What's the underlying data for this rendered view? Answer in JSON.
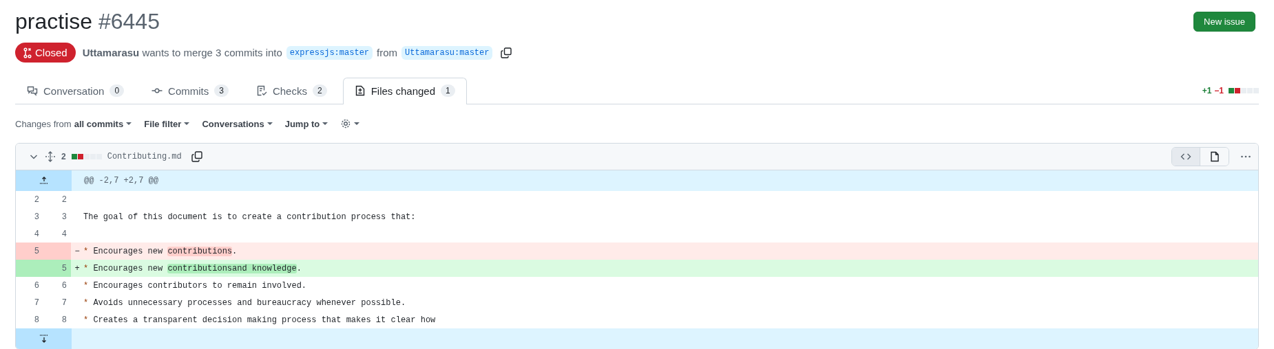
{
  "title": "practise",
  "number": "#6445",
  "new_issue_button": "New issue",
  "status": {
    "label": "Closed",
    "kind": "closed"
  },
  "summary": {
    "author": "Uttamarasu",
    "text": "wants to merge 3 commits into",
    "base": "expressjs:master",
    "from": "from",
    "head": "Uttamarasu:master"
  },
  "tabs": [
    {
      "label": "Conversation",
      "count": "0",
      "selected": false
    },
    {
      "label": "Commits",
      "count": "3",
      "selected": false
    },
    {
      "label": "Checks",
      "count": "2",
      "selected": false
    },
    {
      "label": "Files changed",
      "count": "1",
      "selected": true
    }
  ],
  "totals": {
    "additions": "+1",
    "deletions": "−1",
    "blocks": [
      {
        "color": "#1f883d"
      },
      {
        "color": "#cf222e"
      },
      {
        "color": "#eaeef2"
      },
      {
        "color": "#eaeef2"
      },
      {
        "color": "#eaeef2"
      }
    ]
  },
  "toolbar": {
    "changes_label": "Changes from",
    "changes_value": "all commits",
    "menus": [
      "File filter",
      "Conversations",
      "Jump to"
    ]
  },
  "file": {
    "expanded": true,
    "changes": "2",
    "name": "Contributing.md",
    "blocks": [
      {
        "color": "#1f883d"
      },
      {
        "color": "#cf222e"
      },
      {
        "color": "#eaeef2"
      },
      {
        "color": "#eaeef2"
      },
      {
        "color": "#eaeef2"
      }
    ],
    "lines": [
      {
        "kind": "hunk",
        "text": "@@ -2,7 +2,7 @@"
      },
      {
        "kind": "context",
        "old": "2",
        "new": "2"
      },
      {
        "kind": "context",
        "old": "3",
        "new": "3",
        "segments": [
          {
            "text": "The goal of this document is to create a contribution process that:"
          }
        ]
      },
      {
        "kind": "context",
        "old": "4",
        "new": "4"
      },
      {
        "kind": "deletion",
        "old": "5",
        "sign": "−",
        "segments": [
          {
            "text": "*",
            "bullet": true
          },
          {
            "text": " Encourages new "
          },
          {
            "text": "contributions",
            "highlight": true
          },
          {
            "text": "."
          }
        ]
      },
      {
        "kind": "addition",
        "new": "5",
        "sign": "+",
        "segments": [
          {
            "text": "*",
            "bullet": true
          },
          {
            "text": " Encourages new "
          },
          {
            "text": "contributionsand knowledge",
            "highlight": true
          },
          {
            "text": "."
          }
        ]
      },
      {
        "kind": "context",
        "old": "6",
        "new": "6",
        "segments": [
          {
            "text": "*",
            "bullet": true
          },
          {
            "text": " Encourages contributors to remain involved."
          }
        ]
      },
      {
        "kind": "context",
        "old": "7",
        "new": "7",
        "segments": [
          {
            "text": "*",
            "bullet": true
          },
          {
            "text": " Avoids unnecessary processes and bureaucracy whenever possible."
          }
        ]
      },
      {
        "kind": "context",
        "old": "8",
        "new": "8",
        "segments": [
          {
            "text": "*",
            "bullet": true
          },
          {
            "text": " Creates a transparent decision making process that makes it clear how"
          }
        ]
      },
      {
        "kind": "expand"
      }
    ]
  }
}
